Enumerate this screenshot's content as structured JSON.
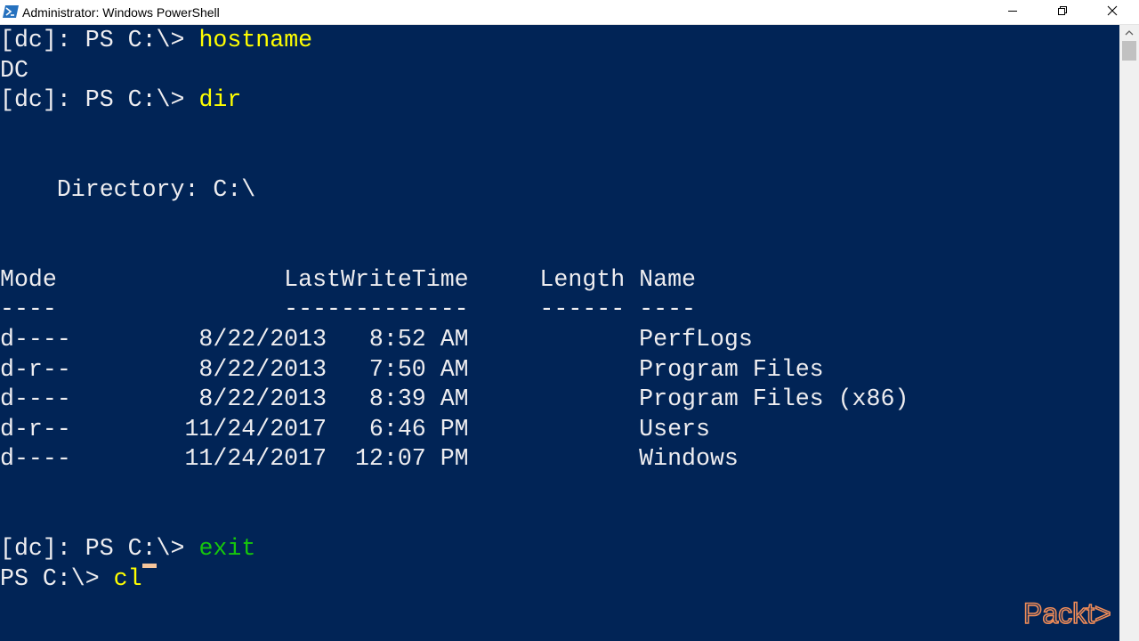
{
  "window": {
    "title": "Administrator: Windows PowerShell",
    "icon": "powershell-icon"
  },
  "controls": {
    "minimize": "minimize-icon",
    "maximize": "restore-icon",
    "close": "close-icon"
  },
  "console": {
    "lines": [
      {
        "prompt": "[dc]: PS C:\\> ",
        "command": "hostname"
      },
      {
        "text": "DC"
      },
      {
        "prompt": "[dc]: PS C:\\> ",
        "command": "dir"
      },
      {
        "text": ""
      },
      {
        "text": ""
      },
      {
        "text": "    Directory: C:\\"
      },
      {
        "text": ""
      },
      {
        "text": ""
      },
      {
        "text": "Mode                LastWriteTime     Length Name"
      },
      {
        "text": "----                -------------     ------ ----"
      },
      {
        "text": "d----         8/22/2013   8:52 AM            PerfLogs"
      },
      {
        "text": "d-r--         8/22/2013   7:50 AM            Program Files"
      },
      {
        "text": "d----         8/22/2013   8:39 AM            Program Files (x86)"
      },
      {
        "text": "d-r--        11/24/2017   6:46 PM            Users"
      },
      {
        "text": "d----        11/24/2017  12:07 PM            Windows"
      },
      {
        "text": ""
      },
      {
        "text": ""
      },
      {
        "prompt": "[dc]: PS C:\\> ",
        "command": "exit"
      },
      {
        "prompt": "PS C:\\> ",
        "command": "cl"
      }
    ]
  },
  "colors": {
    "background": "#012456",
    "text": "#eeedf0",
    "command": "#ffff00",
    "exit_command": "#16c60c",
    "cursor": "#f6c59b",
    "watermark": "#f08c58"
  },
  "watermark": {
    "icon": "packt-logo",
    "text": "Packt>"
  }
}
